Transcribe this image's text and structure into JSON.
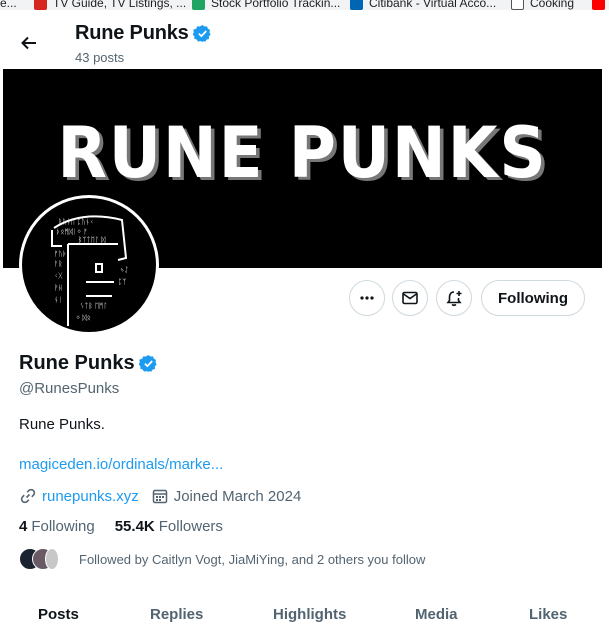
{
  "bookmarks": [
    {
      "label": "e...",
      "icon": "bookmark-icon"
    },
    {
      "label": "TV Guide, TV Listings, ...",
      "icon": "tvguide-icon",
      "color": "#d7261e"
    },
    {
      "label": "Stock Portfolio Trackin...",
      "icon": "spreadsheet-icon",
      "color": "#1fa463"
    },
    {
      "label": "Citibank - Virtual Acco...",
      "icon": "citi-icon",
      "color": "#0066b3"
    },
    {
      "label": "Cooking",
      "icon": "folder-icon"
    },
    {
      "label": "",
      "icon": "youtube-icon",
      "color": "#ff0000"
    }
  ],
  "header": {
    "name": "Rune Punks",
    "posts": "43 posts"
  },
  "banner": {
    "text": "RUNE PUNKS"
  },
  "actions": {
    "following_label": "Following"
  },
  "profile": {
    "name": "Rune Punks",
    "handle": "@RunesPunks",
    "bio": "Rune Punks.",
    "bio_link": "magiceden.io/ordinals/marke...",
    "website": "runepunks.xyz",
    "joined": "Joined March 2024",
    "following_count": "4",
    "following_label": "Following",
    "followers_count": "55.4K",
    "followers_label": "Followers",
    "followed_by": "Followed by Caitlyn Vogt, JiaMiYing, and 2 others you follow"
  },
  "tabs": [
    "Posts",
    "Replies",
    "Highlights",
    "Media",
    "Likes"
  ],
  "colors": {
    "accent": "#1d9bf0",
    "text": "#0f1419",
    "secondary": "#536471",
    "border": "#cfd9de",
    "banner_bg": "#000000"
  }
}
